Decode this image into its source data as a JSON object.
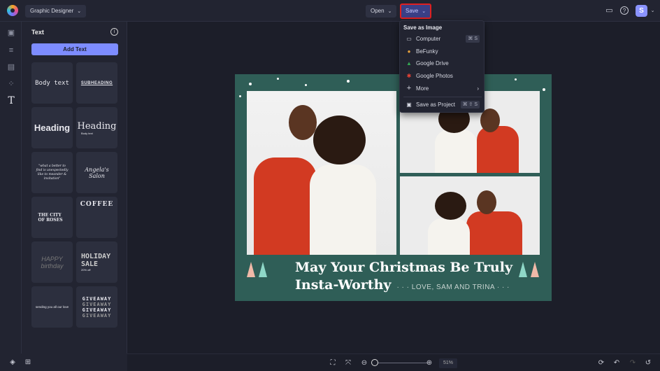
{
  "topbar": {
    "workspace": "Graphic Designer",
    "open": "Open",
    "save": "Save",
    "avatar": "S"
  },
  "panel": {
    "title": "Text",
    "add_text": "Add Text",
    "tiles": {
      "body": "Body text",
      "subheading": "SUBHEADING",
      "heading_sans": "Heading",
      "heading_serif": "Heading",
      "heading_serif_sub": "Body text",
      "script_quote": "\"what a better to find is unexpectedly like to meander & invitation\"",
      "angelas": "Angela's Salon",
      "city": "THE CITY OF ROSES",
      "coffee": "COFFEE",
      "happy": "HAPPY birthday",
      "holiday": "HOLIDAY SALE",
      "holiday_sub": "20% off",
      "sending": "sending you all our love",
      "giveaway": "GIVEAWAY"
    }
  },
  "save_menu": {
    "header": "Save as Image",
    "items": [
      {
        "label": "Computer",
        "shortcut": "⌘ S",
        "icon": "monitor-icon"
      },
      {
        "label": "BeFunky",
        "icon": "befunky-icon"
      },
      {
        "label": "Google Drive",
        "icon": "google-drive-icon"
      },
      {
        "label": "Google Photos",
        "icon": "google-photos-icon"
      },
      {
        "label": "More",
        "icon": "plus-icon"
      },
      {
        "label": "Save as Project",
        "shortcut": "⌘ ⇧ S",
        "icon": "project-icon"
      }
    ]
  },
  "design": {
    "line1": "May Your Christmas Be Truly",
    "line2": "Insta-Worthy",
    "signature": "· · · LOVE, SAM AND TRINA · · ·",
    "bg_color": "#2f5e57"
  },
  "bottombar": {
    "zoom": "51%",
    "zoom_fraction": 0.05
  }
}
